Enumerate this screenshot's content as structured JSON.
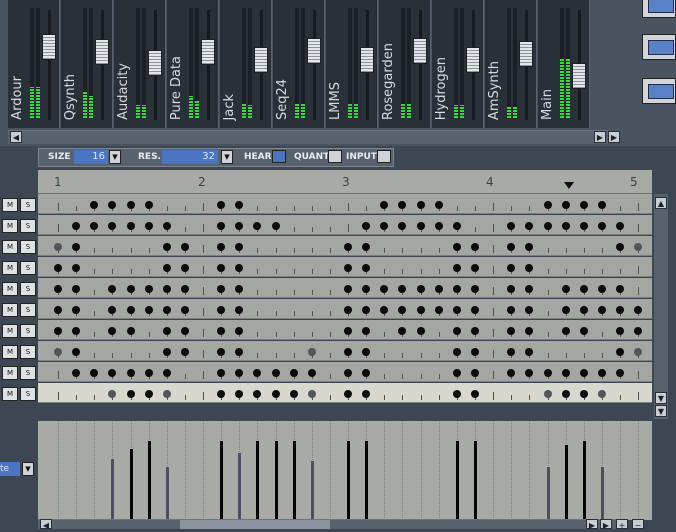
{
  "mixer": {
    "strips": [
      {
        "label": "Ardour",
        "fader": 0.66,
        "meters": [
          0.28,
          0.28
        ]
      },
      {
        "label": "Qsynth",
        "fader": 0.62,
        "meters": [
          0.24,
          0.2
        ]
      },
      {
        "label": "Audacity",
        "fader": 0.52,
        "meters": [
          0.12,
          0.12
        ]
      },
      {
        "label": "Pure Data",
        "fader": 0.62,
        "meters": [
          0.2,
          0.16
        ]
      },
      {
        "label": "Jack",
        "fader": 0.55,
        "meters": [
          0.14,
          0.12
        ]
      },
      {
        "label": "Seq24",
        "fader": 0.63,
        "meters": [
          0.14,
          0.14
        ]
      },
      {
        "label": "LMMS",
        "fader": 0.55,
        "meters": [
          0.13,
          0.13
        ]
      },
      {
        "label": "Rosegarden",
        "fader": 0.63,
        "meters": [
          0.14,
          0.14
        ]
      },
      {
        "label": "Hydrogen",
        "fader": 0.55,
        "meters": [
          0.12,
          0.12
        ]
      },
      {
        "label": "AmSynth",
        "fader": 0.6,
        "meters": [
          0.11,
          0.11
        ]
      },
      {
        "label": "Main",
        "fader": 0.4,
        "meters": [
          0.55,
          0.55
        ]
      }
    ]
  },
  "toolbar": {
    "size_label": "SIZE",
    "size_value": "16",
    "res_label": "RES.",
    "res_value": "32",
    "hear_label": "HEAR",
    "quant_label": "QUANT",
    "input_label": "INPUT"
  },
  "ruler": {
    "beats": [
      "1",
      "2",
      "3",
      "4",
      "5"
    ],
    "playhead_beat": 4.55
  },
  "track_buttons": {
    "mute": "M",
    "solo": "S"
  },
  "velocity_mode": "te",
  "pattern": {
    "steps": 32,
    "rows": [
      {
        "steps": [
          2,
          3,
          4,
          5,
          9,
          10,
          18,
          19,
          20,
          21,
          27,
          28,
          29,
          30
        ],
        "soft": [],
        "selected": false
      },
      {
        "steps": [
          1,
          2,
          3,
          4,
          5,
          6,
          9,
          10,
          11,
          12,
          17,
          18,
          19,
          20,
          21,
          22,
          25,
          26,
          27,
          28,
          29,
          30,
          31
        ],
        "soft": [],
        "selected": false
      },
      {
        "steps": [
          0,
          1,
          6,
          7,
          9,
          10,
          16,
          17,
          22,
          23,
          25,
          26,
          31,
          32
        ],
        "soft": [
          0,
          32
        ],
        "selected": false
      },
      {
        "steps": [
          0,
          1,
          6,
          7,
          9,
          10,
          16,
          17,
          22,
          23,
          25,
          26
        ],
        "soft": [],
        "selected": false
      },
      {
        "steps": [
          0,
          1,
          3,
          4,
          5,
          6,
          7,
          9,
          10,
          16,
          17,
          18,
          19,
          20,
          21,
          22,
          23,
          25,
          26,
          28,
          29,
          30,
          31
        ],
        "soft": [],
        "selected": false
      },
      {
        "steps": [
          0,
          1,
          3,
          4,
          5,
          6,
          7,
          9,
          10,
          16,
          17,
          18,
          19,
          20,
          21,
          22,
          23,
          25,
          26,
          28,
          29,
          30,
          31,
          32
        ],
        "soft": [],
        "selected": false
      },
      {
        "steps": [
          0,
          1,
          3,
          4,
          6,
          7,
          9,
          10,
          16,
          17,
          19,
          20,
          22,
          23,
          25,
          26,
          28,
          29,
          31,
          32
        ],
        "soft": [],
        "selected": false
      },
      {
        "steps": [
          0,
          1,
          6,
          7,
          9,
          10,
          14,
          16,
          17,
          22,
          23,
          25,
          26,
          31,
          32
        ],
        "soft": [
          0,
          14,
          32
        ],
        "selected": false
      },
      {
        "steps": [
          1,
          2,
          3,
          4,
          5,
          6,
          9,
          10,
          11,
          12,
          13,
          14,
          16,
          17,
          22,
          23,
          25,
          26,
          27,
          28,
          29,
          30,
          31
        ],
        "soft": [],
        "selected": false
      },
      {
        "steps": [
          3,
          4,
          5,
          6,
          9,
          10,
          11,
          12,
          13,
          14,
          16,
          17,
          22,
          23,
          27,
          28,
          29,
          30
        ],
        "soft": [
          3,
          6,
          14,
          27,
          30
        ],
        "selected": true
      }
    ]
  },
  "velocity": [
    {
      "step": 3,
      "v": 0.62,
      "soft": true
    },
    {
      "step": 4,
      "v": 0.72,
      "soft": false
    },
    {
      "step": 5,
      "v": 0.8,
      "soft": false
    },
    {
      "step": 6,
      "v": 0.54,
      "soft": true
    },
    {
      "step": 9,
      "v": 0.8,
      "soft": false
    },
    {
      "step": 10,
      "v": 0.68,
      "soft": true
    },
    {
      "step": 11,
      "v": 0.8,
      "soft": false
    },
    {
      "step": 12,
      "v": 0.8,
      "soft": false
    },
    {
      "step": 13,
      "v": 0.8,
      "soft": false
    },
    {
      "step": 14,
      "v": 0.6,
      "soft": true
    },
    {
      "step": 16,
      "v": 0.8,
      "soft": false
    },
    {
      "step": 17,
      "v": 0.8,
      "soft": false
    },
    {
      "step": 22,
      "v": 0.8,
      "soft": false
    },
    {
      "step": 23,
      "v": 0.8,
      "soft": false
    },
    {
      "step": 27,
      "v": 0.54,
      "soft": true
    },
    {
      "step": 28,
      "v": 0.76,
      "soft": false
    },
    {
      "step": 29,
      "v": 0.8,
      "soft": false
    },
    {
      "step": 30,
      "v": 0.54,
      "soft": true
    }
  ]
}
